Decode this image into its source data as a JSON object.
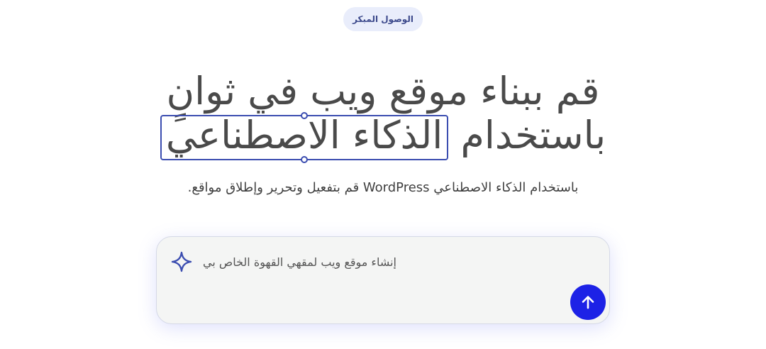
{
  "badge": {
    "label": "الوصول المبكر"
  },
  "hero": {
    "line1": "قم ببناء موقع ويب في ثوانٍ",
    "line2_lead": "باستخدام",
    "line2_highlight": "الذكاء الاصطناعي",
    "subtitle": "باستخدام الذكاء الاصطناعي WordPress قم بتفعيل وتحرير وإطلاق مواقع."
  },
  "prompt": {
    "placeholder": "إنشاء موقع ويب لمقهي القهوة الخاص بي...",
    "icon": "sparkle-icon",
    "send_icon": "arrow-up-icon"
  },
  "colors": {
    "accent": "#1d22e6",
    "highlight_border": "#3b4db0",
    "badge_bg": "#e9edfb",
    "badge_text": "#3d4a8c"
  }
}
